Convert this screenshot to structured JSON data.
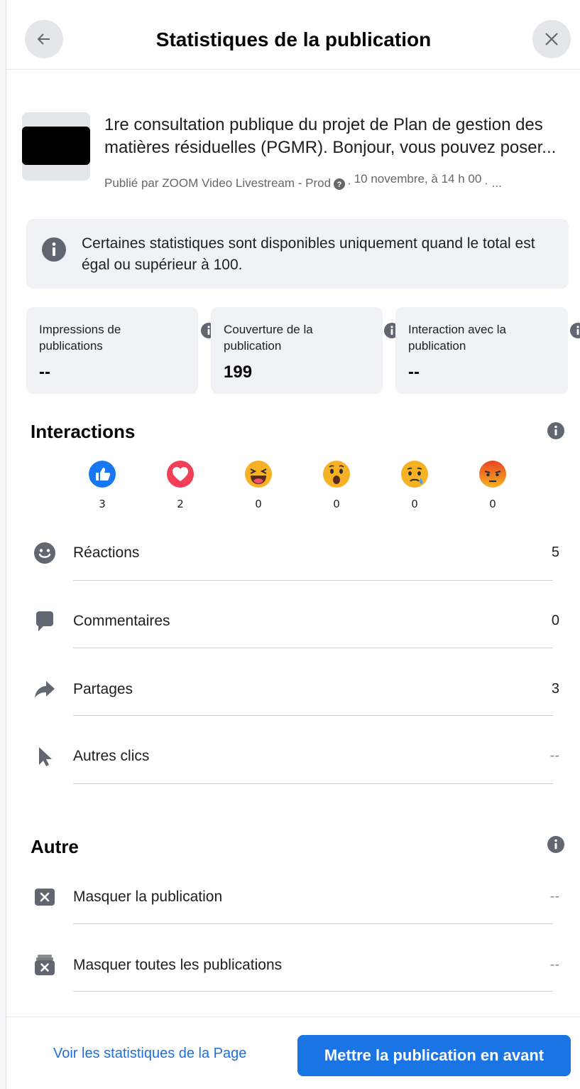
{
  "header": {
    "title": "Statistiques de la publication",
    "back_icon": "arrow-left-icon",
    "close_icon": "close-icon"
  },
  "post": {
    "text": "1re consultation publique du projet de Plan de gestion des matières résiduelles (PGMR). Bonjour, vous pouvez poser...",
    "published_by": "Publié par ZOOM Video Livestream - Prod",
    "separator": "·",
    "date": "10 novembre, à 14 h 00",
    "trailing": "· ..."
  },
  "notice": {
    "text": "Certaines statistiques sont disponibles uniquement quand le total est égal ou supérieur à 100."
  },
  "stats": [
    {
      "label": "Impressions de publications",
      "value": "--"
    },
    {
      "label": "Couverture de la publication",
      "value": "199"
    },
    {
      "label": "Interaction avec la publication",
      "value": "--"
    }
  ],
  "interactions": {
    "title": "Interactions",
    "reactions": [
      {
        "name": "like",
        "count": "3",
        "color": "#1877f2"
      },
      {
        "name": "love",
        "count": "2",
        "color": "#f33e58"
      },
      {
        "name": "haha",
        "count": "0",
        "color": "#f7b125"
      },
      {
        "name": "wow",
        "count": "0",
        "color": "#f7b125"
      },
      {
        "name": "sad",
        "count": "0",
        "color": "#f7b125"
      },
      {
        "name": "angry",
        "count": "0",
        "color": "#e9710f"
      }
    ],
    "rows": [
      {
        "label": "Réactions",
        "value": "5"
      },
      {
        "label": "Commentaires",
        "value": "0"
      },
      {
        "label": "Partages",
        "value": "3"
      },
      {
        "label": "Autres clics",
        "value": "--"
      }
    ]
  },
  "other": {
    "title": "Autre",
    "rows": [
      {
        "label": "Masquer la publication",
        "value": "--"
      },
      {
        "label": "Masquer toutes les publications",
        "value": "--"
      }
    ]
  },
  "footer": {
    "page_stats_link": "Voir les statistiques de la Page",
    "boost_button": "Mettre la publication en avant"
  },
  "colors": {
    "accent": "#1b74e4",
    "link": "#216fdb",
    "card_bg": "#f0f2f5",
    "icon_gray": "#65676b"
  }
}
